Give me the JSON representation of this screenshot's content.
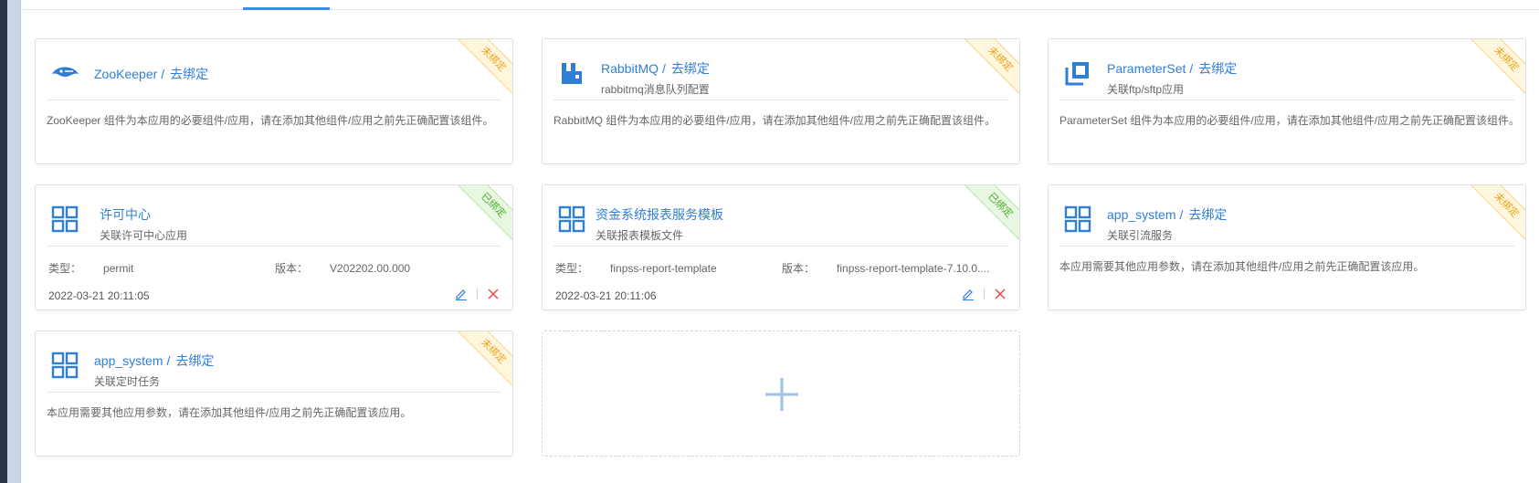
{
  "colors": {
    "accent": "#2f7ed8",
    "unbound": "#e8a317",
    "bound": "#4cae2c",
    "delete": "#e14a45"
  },
  "cards": [
    {
      "title": "ZooKeeper",
      "bind_action": "去绑定",
      "subtitle": "",
      "status": "未绑定",
      "description": "ZooKeeper 组件为本应用的必要组件/应用，请在添加其他组件/应用之前先正确配置该组件。",
      "icon": "zookeeper-icon"
    },
    {
      "title": "RabbitMQ",
      "bind_action": "去绑定",
      "subtitle": "rabbitmq消息队列配置",
      "status": "未绑定",
      "description": "RabbitMQ 组件为本应用的必要组件/应用，请在添加其他组件/应用之前先正确配置该组件。",
      "icon": "rabbitmq-icon"
    },
    {
      "title": "ParameterSet",
      "bind_action": "去绑定",
      "subtitle": "关联ftp/sftp应用",
      "status": "未绑定",
      "description": "ParameterSet 组件为本应用的必要组件/应用，请在添加其他组件/应用之前先正确配置该组件。",
      "icon": "parameterset-icon"
    },
    {
      "title": "许可中心",
      "subtitle": "关联许可中心应用",
      "status": "已绑定",
      "type_label": "类型：",
      "type_value": "permit",
      "version_label": "版本：",
      "version_value": "V202202.00.000",
      "date": "2022-03-21 20:11:05",
      "icon": "grid-app-icon"
    },
    {
      "title": "资金系统报表服务模板",
      "subtitle": "关联报表模板文件",
      "status": "已绑定",
      "type_label": "类型：",
      "type_value": "finpss-report-template",
      "version_label": "版本：",
      "version_value": "finpss-report-template-7.10.0....",
      "date": "2022-03-21 20:11:06",
      "icon": "grid-app-icon"
    },
    {
      "title": "app_system",
      "bind_action": "去绑定",
      "subtitle": "关联引流服务",
      "status": "未绑定",
      "description": "本应用需要其他应用参数，请在添加其他组件/应用之前先正确配置该应用。",
      "icon": "grid-app-icon"
    },
    {
      "title": "app_system",
      "bind_action": "去绑定",
      "subtitle": "关联定时任务",
      "status": "未绑定",
      "description": "本应用需要其他应用参数，请在添加其他组件/应用之前先正确配置该应用。",
      "icon": "grid-app-icon"
    }
  ],
  "add_card": {
    "icon": "plus-icon"
  }
}
